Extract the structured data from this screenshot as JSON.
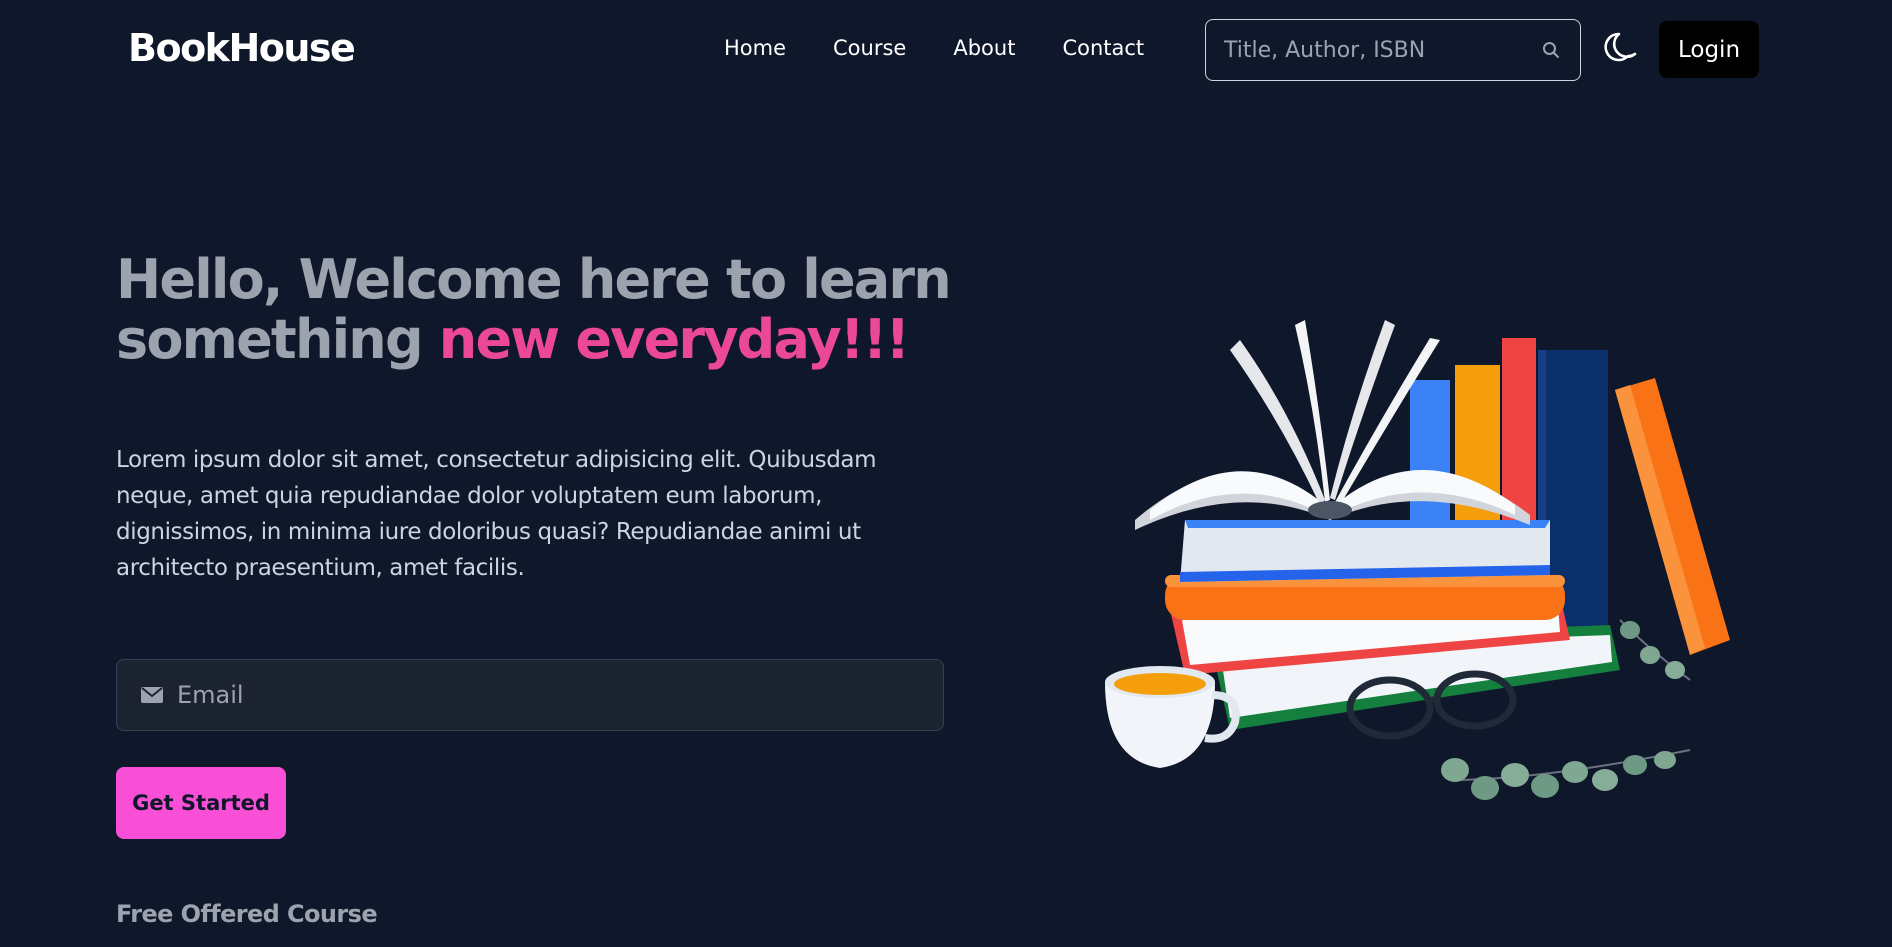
{
  "navbar": {
    "brand": "BookHouse",
    "links": [
      "Home",
      "Course",
      "About",
      "Contact"
    ],
    "search_placeholder": "Title, Author, ISBN",
    "login_label": "Login"
  },
  "hero": {
    "title_main": "Hello, Welcome here to learn something ",
    "title_accent": "new everyday!!!",
    "description": "Lorem ipsum dolor sit amet, consectetur adipisicing elit. Quibusdam neque, amet quia repudiandae dolor voluptatem eum laborum, dignissimos, in minima iure doloribus quasi? Repudiandae animi ut architecto praesentium, amet facilis.",
    "email_placeholder": "Email",
    "cta_label": "Get Started"
  },
  "section": {
    "heading": "Free Offered Course"
  },
  "icons": {
    "search": "search-icon",
    "theme": "moon-icon",
    "email": "envelope-icon",
    "illustration": "books-illustration"
  },
  "colors": {
    "background": "#0f172a",
    "accent": "#ec4899",
    "cta": "#f94fd7",
    "login": "#000000"
  }
}
